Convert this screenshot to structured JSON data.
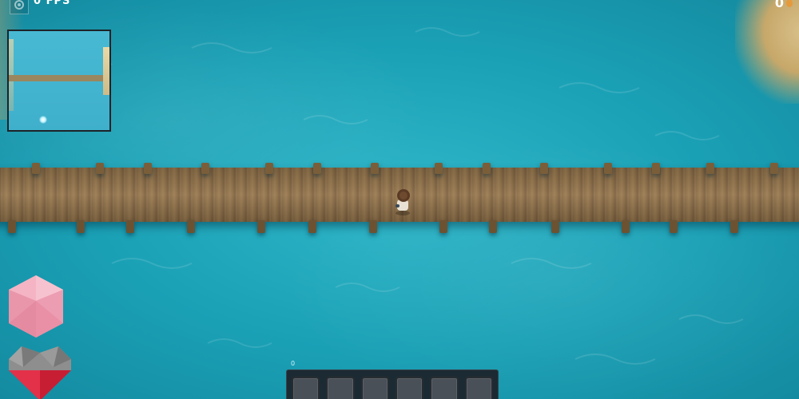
{
  "hud": {
    "fps_text": "0 FPS",
    "currency_value": "0",
    "hotbar_label": "0",
    "hotbar_slots": [
      "",
      "",
      "",
      "",
      "",
      ""
    ]
  },
  "icons": {
    "fps_toggle": "gear-icon",
    "currency": "coin-icon",
    "mana": "gem-icon",
    "health": "heart-icon"
  },
  "colors": {
    "water": "#1aa3b8",
    "bridge_wood": "#8d7048",
    "gem_pink": "#f2a6b8",
    "heart_red": "#d8263d",
    "heart_grey": "#8a8a8a",
    "hotbar_bg": "#1c2228",
    "slot_bg": "#4a5057",
    "coin": "#e59a3c"
  }
}
